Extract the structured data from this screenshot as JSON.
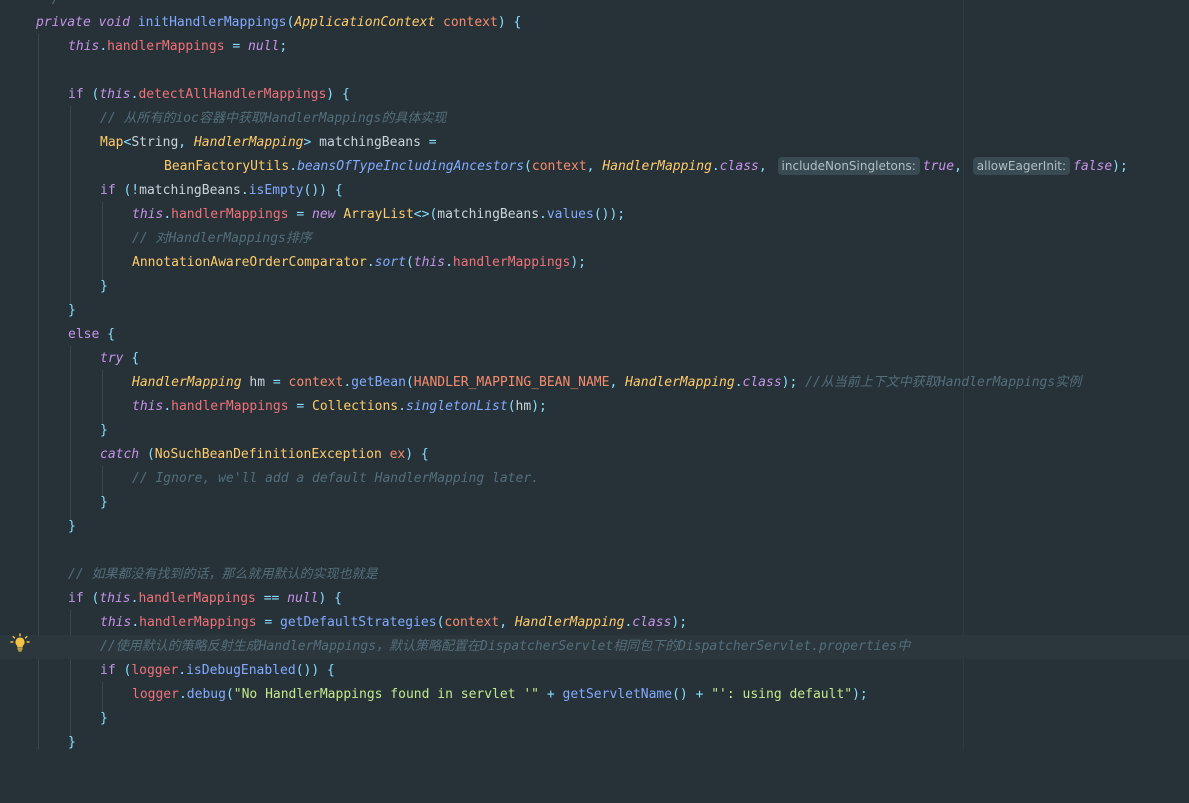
{
  "editor": {
    "theme_colors": {
      "background": "#263238",
      "keyword": "#c792ea",
      "type": "#ffcb6b",
      "function": "#82aaff",
      "field": "#f07178",
      "comment": "#546e7a",
      "string": "#c3e88d"
    },
    "bulb_icon": "lightbulb-icon",
    "lines": {
      "l0": "*/",
      "l1_private": "private",
      "l1_void": "void",
      "l1_name": "initHandlerMappings",
      "l1_type": "ApplicationContext",
      "l1_param": "context",
      "l2_this": "this",
      "l2_field": "handlerMappings",
      "l2_null": "null",
      "l4_if": "if",
      "l4_this": "this",
      "l4_field": "detectAllHandlerMappings",
      "l5_comment": "// 从所有的ioc容器中获取HandlerMappings的具体实现",
      "l6_map": "Map",
      "l6_string": "String",
      "l6_hm": "HandlerMapping",
      "l6_var": "matchingBeans",
      "l7_utils": "BeanFactoryUtils",
      "l7_method": "beansOfTypeIncludingAncestors",
      "l7_ctx": "context",
      "l7_hm": "HandlerMapping",
      "l7_class": "class",
      "l7_hint1": "includeNonSingletons:",
      "l7_true": "true",
      "l7_hint2": "allowEagerInit:",
      "l7_false": "false",
      "l8_if": "if",
      "l8_var": "matchingBeans",
      "l8_method": "isEmpty",
      "l9_this": "this",
      "l9_field": "handlerMappings",
      "l9_new": "new",
      "l9_list": "ArrayList",
      "l9_var": "matchingBeans",
      "l9_method": "values",
      "l10_comment": "// 对HandlerMappings排序",
      "l11_cls": "AnnotationAwareOrderComparator",
      "l11_method": "sort",
      "l11_this": "this",
      "l11_field": "handlerMappings",
      "l14_else": "else",
      "l15_try": "try",
      "l16_hm": "HandlerMapping",
      "l16_var": "hm",
      "l16_ctx": "context",
      "l16_method": "getBean",
      "l16_const": "HANDLER_MAPPING_BEAN_NAME",
      "l16_hm2": "HandlerMapping",
      "l16_class": "class",
      "l16_comment": "//从当前上下文中获取HandlerMappings实例",
      "l17_this": "this",
      "l17_field": "handlerMappings",
      "l17_cls": "Collections",
      "l17_method": "singletonList",
      "l17_var": "hm",
      "l19_catch": "catch",
      "l19_exc": "NoSuchBeanDefinitionException",
      "l19_var": "ex",
      "l20_comment": "// Ignore, we'll add a default HandlerMapping later.",
      "l24_comment": "// 如果都没有找到的话，那么就用默认的实现也就是",
      "l25_if": "if",
      "l25_this": "this",
      "l25_field": "handlerMappings",
      "l25_null": "null",
      "l26_this": "this",
      "l26_field": "handlerMappings",
      "l26_method": "getDefaultStrategies",
      "l26_ctx": "context",
      "l26_hm": "HandlerMapping",
      "l26_class": "class",
      "l27_comment": "//使用默认的策略反射生成HandlerMappings，默认策略配置在DispatcherServlet相同包下的DispatcherServlet.properties中",
      "l28_if": "if",
      "l28_logger": "logger",
      "l28_method": "isDebugEnabled",
      "l29_logger": "logger",
      "l29_method": "debug",
      "l29_str1": "\"No HandlerMappings found in servlet '\"",
      "l29_method2": "getServletName",
      "l29_str2": "\"': using default\""
    }
  }
}
